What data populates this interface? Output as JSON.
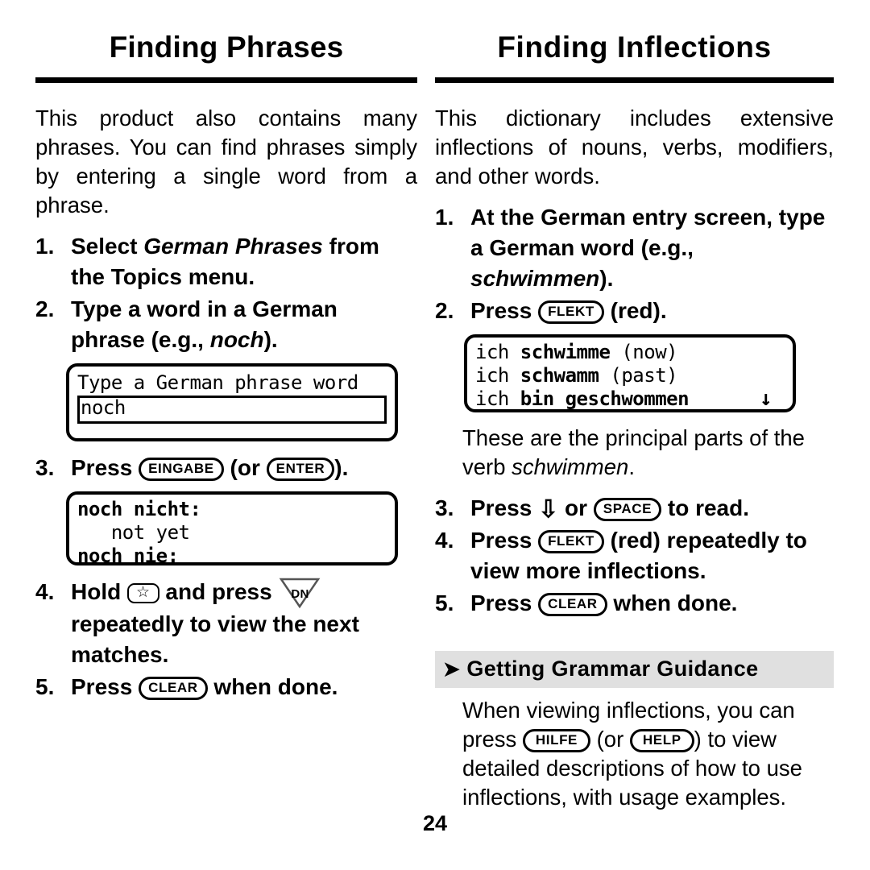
{
  "page": {
    "number": "24"
  },
  "left_column": {
    "title": "Finding Phrases",
    "intro": "This product also contains many phrases. You can find phrases simply by entering a single word from a phrase.",
    "steps": [
      {
        "num": "1.",
        "pre": "Select ",
        "italic": "German Phrases",
        "post": " from the Topics menu."
      },
      {
        "num": "2.",
        "pre": "Type a word in a German phrase (e.g., ",
        "italic": "noch",
        "post": ")."
      },
      {
        "num": "3.",
        "pre": "Press ",
        "key1": "EINGABE",
        "mid": " (or ",
        "key2": "ENTER",
        "post": ")."
      },
      {
        "num": "4.",
        "pre": "Hold ",
        "key_star": "☆",
        "mid": " and press ",
        "key_dn": "DN",
        "post": " repeatedly to view the next matches."
      },
      {
        "num": "5.",
        "pre": "Press ",
        "key1": "CLEAR",
        "post": " when done."
      }
    ],
    "screen_entry": {
      "prompt": "Type a German phrase word",
      "typed": "noch"
    },
    "screen_results": {
      "line1": "noch nicht:",
      "line2": "   not yet",
      "line3": "noch nie:"
    }
  },
  "right_column": {
    "title": "Finding Inflections",
    "intro": "This dictionary includes extensive inflections of nouns, verbs, modifiers, and other words.",
    "steps": [
      {
        "num": "1.",
        "pre": "At the German entry screen, type a German word (e.g., ",
        "italic": "schwimmen",
        "post": ")."
      },
      {
        "num": "2.",
        "pre": "Press ",
        "key1": "FLEKT",
        "post": " (red)."
      },
      {
        "num": "3.",
        "pre": "Press ",
        "arrow": "⇩",
        "mid": " or ",
        "key1": "SPACE",
        "post": " to read."
      },
      {
        "num": "4.",
        "pre": "Press ",
        "key1": "FLEKT",
        "post": " (red) repeatedly to view more inflections."
      },
      {
        "num": "5.",
        "pre": "Press ",
        "key1": "CLEAR",
        "post": " when done."
      }
    ],
    "screen_inflections": {
      "line1_plain": "ich ",
      "line1_bold": "schwimme",
      "line1_tail": " (now)",
      "line2_plain": "ich ",
      "line2_bold": "schwamm",
      "line2_tail": " (past)",
      "line3_plain": "ich ",
      "line3_bold": "bin geschwommen",
      "line3_tail": "",
      "scroll_marker": "↓"
    },
    "caption_pre": "These are the principal parts of the verb ",
    "caption_italic": "schwimmen",
    "caption_post": ".",
    "banner": {
      "bullet": "➤",
      "label": "Getting Grammar Guidance"
    },
    "guidance": {
      "part1": "When viewing inflections, you can press ",
      "key1": "HILFE",
      "part2": " (or ",
      "key2": "HELP",
      "part3": ") to view detailed descriptions of how to use inflections, with usage examples."
    }
  }
}
